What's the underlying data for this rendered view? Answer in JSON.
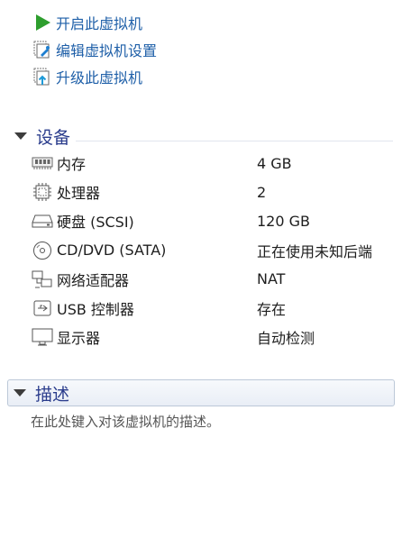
{
  "actions": [
    {
      "label": "开启此虚拟机",
      "icon": "play-icon"
    },
    {
      "label": "编辑虚拟机设置",
      "icon": "edit-settings-icon"
    },
    {
      "label": "升级此虚拟机",
      "icon": "upgrade-icon"
    }
  ],
  "devices_section": {
    "title": "设备",
    "items": [
      {
        "name": "内存",
        "value": "4 GB",
        "icon": "memory-icon"
      },
      {
        "name": "处理器",
        "value": "2",
        "icon": "processor-icon"
      },
      {
        "name": "硬盘 (SCSI)",
        "value": "120 GB",
        "icon": "hard-disk-icon"
      },
      {
        "name": "CD/DVD (SATA)",
        "value": "正在使用未知后端",
        "icon": "cd-dvd-icon"
      },
      {
        "name": "网络适配器",
        "value": "NAT",
        "icon": "network-adapter-icon"
      },
      {
        "name": "USB 控制器",
        "value": "存在",
        "icon": "usb-controller-icon"
      },
      {
        "name": "显示器",
        "value": "自动检测",
        "icon": "display-icon"
      }
    ]
  },
  "description_section": {
    "title": "描述",
    "placeholder": "在此处键入对该虚拟机的描述。"
  },
  "colors": {
    "link": "#1e5fa8",
    "section_title": "#2a3c8c",
    "play_green": "#2e9e2e"
  }
}
